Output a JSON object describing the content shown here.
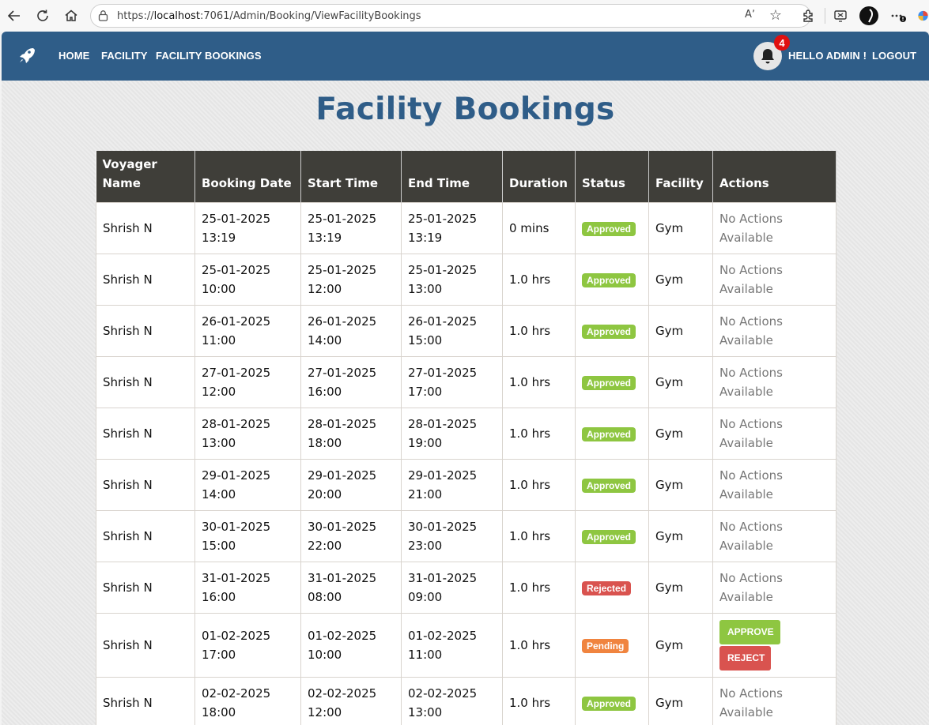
{
  "browser": {
    "url_prefix": "https://",
    "url_host": "localhost",
    "url_rest": ":7061/Admin/Booking/ViewFacilityBookings",
    "read_aloud_label": "Aʼ"
  },
  "navbar": {
    "links": [
      "HOME",
      "FACILITY",
      "FACILITY BOOKINGS"
    ],
    "notification_count": "4",
    "greeting": "HELLO ADMIN !",
    "logout": "LOGOUT"
  },
  "page": {
    "title": "Facility Bookings"
  },
  "table": {
    "headers": [
      "Voyager Name",
      "Booking Date",
      "Start Time",
      "End Time",
      "Duration",
      "Status",
      "Facility",
      "Actions"
    ],
    "no_actions_text": "No Actions Available",
    "approve_label": "APPROVE",
    "reject_label": "REJECT",
    "status_colors": {
      "Approved": "#8ec641",
      "Rejected": "#d9534f",
      "Pending": "#f0843f"
    },
    "rows": [
      {
        "name": "Shrish N",
        "booking_date": "25-01-2025",
        "booking_time": "13:19",
        "start_date": "25-01-2025",
        "start_time": "13:19",
        "end_date": "25-01-2025",
        "end_time": "13:19",
        "duration": "0 mins",
        "status": "Approved",
        "facility": "Gym"
      },
      {
        "name": "Shrish N",
        "booking_date": "25-01-2025",
        "booking_time": "10:00",
        "start_date": "25-01-2025",
        "start_time": "12:00",
        "end_date": "25-01-2025",
        "end_time": "13:00",
        "duration": "1.0 hrs",
        "status": "Approved",
        "facility": "Gym"
      },
      {
        "name": "Shrish N",
        "booking_date": "26-01-2025",
        "booking_time": "11:00",
        "start_date": "26-01-2025",
        "start_time": "14:00",
        "end_date": "26-01-2025",
        "end_time": "15:00",
        "duration": "1.0 hrs",
        "status": "Approved",
        "facility": "Gym"
      },
      {
        "name": "Shrish N",
        "booking_date": "27-01-2025",
        "booking_time": "12:00",
        "start_date": "27-01-2025",
        "start_time": "16:00",
        "end_date": "27-01-2025",
        "end_time": "17:00",
        "duration": "1.0 hrs",
        "status": "Approved",
        "facility": "Gym"
      },
      {
        "name": "Shrish N",
        "booking_date": "28-01-2025",
        "booking_time": "13:00",
        "start_date": "28-01-2025",
        "start_time": "18:00",
        "end_date": "28-01-2025",
        "end_time": "19:00",
        "duration": "1.0 hrs",
        "status": "Approved",
        "facility": "Gym"
      },
      {
        "name": "Shrish N",
        "booking_date": "29-01-2025",
        "booking_time": "14:00",
        "start_date": "29-01-2025",
        "start_time": "20:00",
        "end_date": "29-01-2025",
        "end_time": "21:00",
        "duration": "1.0 hrs",
        "status": "Approved",
        "facility": "Gym"
      },
      {
        "name": "Shrish N",
        "booking_date": "30-01-2025",
        "booking_time": "15:00",
        "start_date": "30-01-2025",
        "start_time": "22:00",
        "end_date": "30-01-2025",
        "end_time": "23:00",
        "duration": "1.0 hrs",
        "status": "Approved",
        "facility": "Gym"
      },
      {
        "name": "Shrish N",
        "booking_date": "31-01-2025",
        "booking_time": "16:00",
        "start_date": "31-01-2025",
        "start_time": "08:00",
        "end_date": "31-01-2025",
        "end_time": "09:00",
        "duration": "1.0 hrs",
        "status": "Rejected",
        "facility": "Gym"
      },
      {
        "name": "Shrish N",
        "booking_date": "01-02-2025",
        "booking_time": "17:00",
        "start_date": "01-02-2025",
        "start_time": "10:00",
        "end_date": "01-02-2025",
        "end_time": "11:00",
        "duration": "1.0 hrs",
        "status": "Pending",
        "facility": "Gym"
      },
      {
        "name": "Shrish N",
        "booking_date": "02-02-2025",
        "booking_time": "18:00",
        "start_date": "02-02-2025",
        "start_time": "12:00",
        "end_date": "02-02-2025",
        "end_time": "13:00",
        "duration": "1.0 hrs",
        "status": "Approved",
        "facility": "Gym"
      }
    ]
  }
}
